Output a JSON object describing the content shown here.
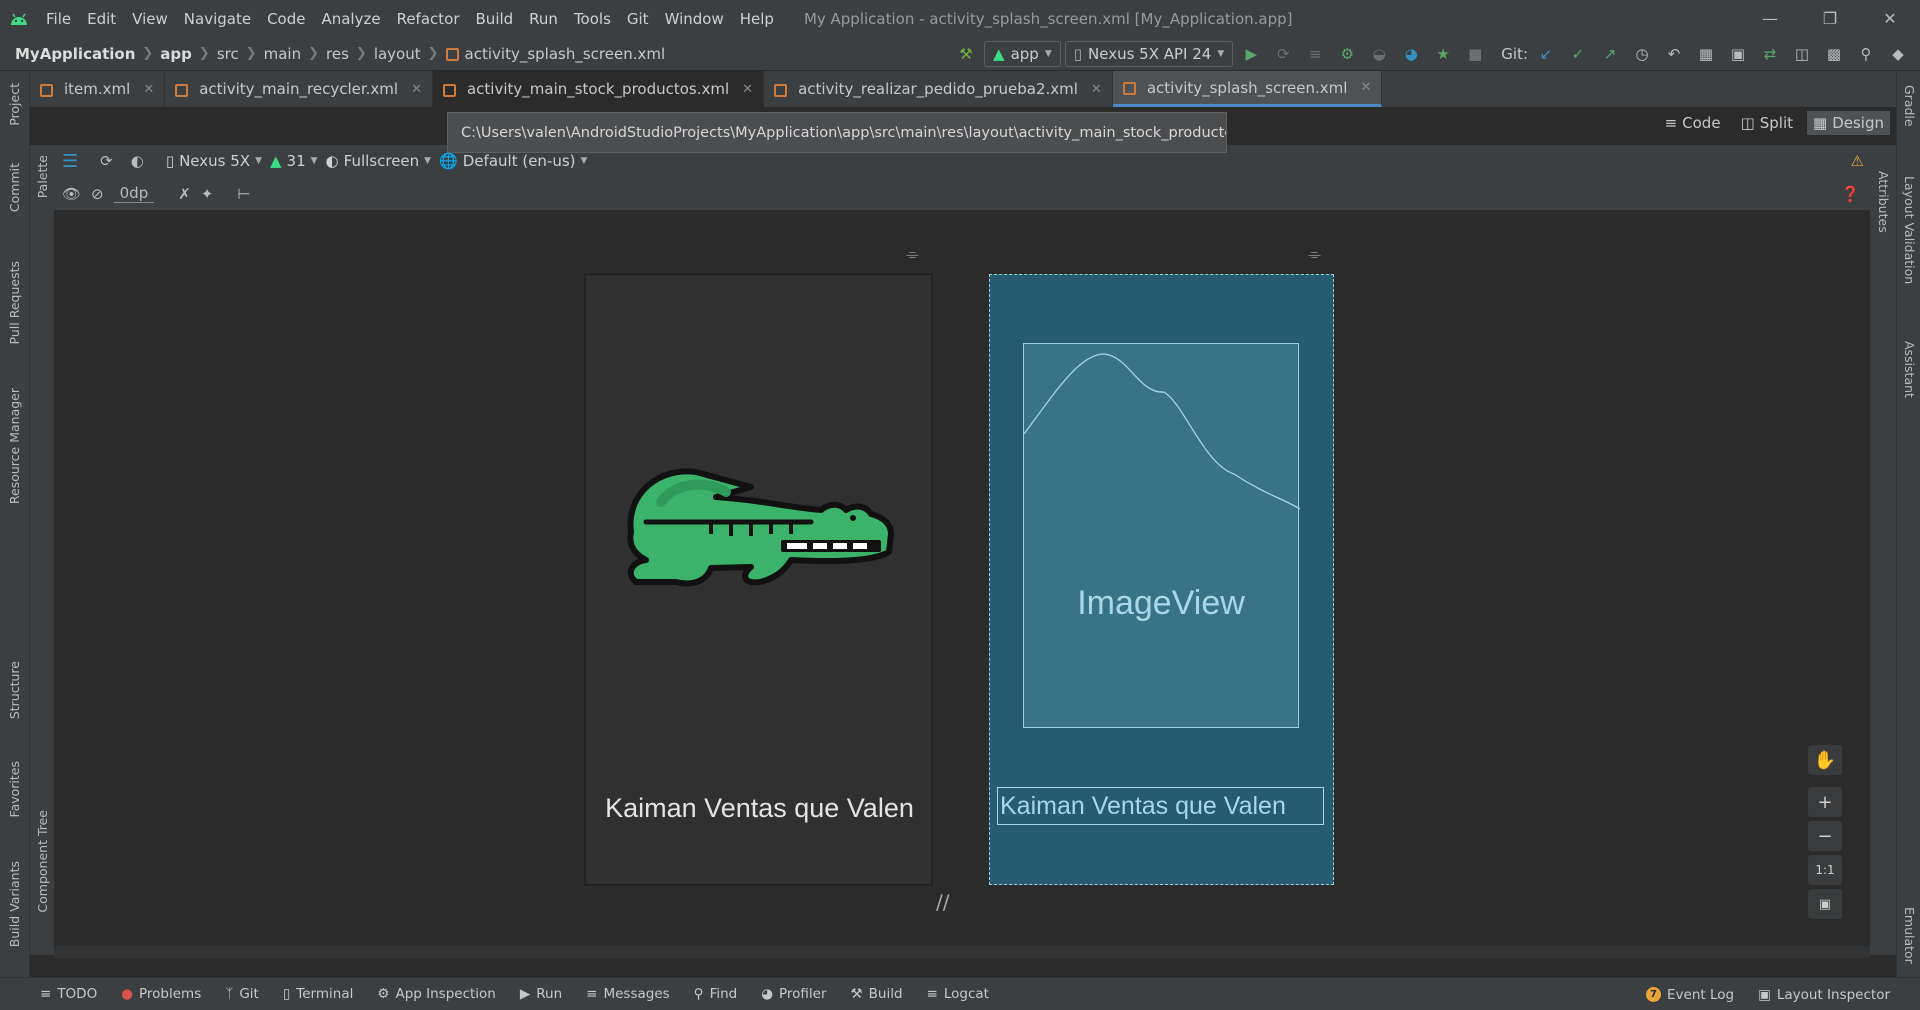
{
  "menubar": {
    "items": [
      "File",
      "Edit",
      "View",
      "Navigate",
      "Code",
      "Analyze",
      "Refactor",
      "Build",
      "Run",
      "Tools",
      "Git",
      "Window",
      "Help"
    ],
    "window_title": "My Application - activity_splash_screen.xml [My_Application.app]"
  },
  "breadcrumb": {
    "items": [
      "MyApplication",
      "app",
      "src",
      "main",
      "res",
      "layout",
      "activity_splash_screen.xml"
    ]
  },
  "toolbar": {
    "run_config": "app",
    "device": "Nexus 5X API 24",
    "git_label": "Git:"
  },
  "tabs": [
    {
      "label": "item.xml"
    },
    {
      "label": "activity_main_recycler.xml"
    },
    {
      "label": "activity_main_stock_productos.xml"
    },
    {
      "label": "activity_realizar_pedido_prueba2.xml"
    },
    {
      "label": "activity_splash_screen.xml"
    }
  ],
  "tooltip": {
    "path": "C:\\Users\\valen\\AndroidStudioProjects\\MyApplication\\app\\src\\main\\res\\layout\\activity_main_stock_productos.xml"
  },
  "view_modes": {
    "code": "Code",
    "split": "Split",
    "design": "Design"
  },
  "design_toolbar": {
    "device": "Nexus 5X",
    "api": "31",
    "mode": "Fullscreen",
    "locale": "Default (en-us)",
    "margin": "0dp"
  },
  "left_tools": {
    "project": "Project",
    "commit": "Commit",
    "pull_requests": "Pull Requests",
    "resource_manager": "Resource Manager",
    "structure": "Structure",
    "favorites": "Favorites",
    "build_variants": "Build Variants"
  },
  "inner_left_tools": {
    "palette": "Palette",
    "component_tree": "Component Tree"
  },
  "right_tools": {
    "gradle": "Gradle",
    "layout_validation": "Layout Validation",
    "assistant": "Assistant",
    "emulator": "Emulator",
    "attributes": "Attributes"
  },
  "preview": {
    "app_title": "Kaiman Ventas que Valen",
    "imageview_label": "ImageView",
    "textview_text": "Kaiman Ventas que Valen"
  },
  "zoom": {
    "plus": "+",
    "minus": "−",
    "one_to_one": "1:1"
  },
  "statusbar": {
    "todo": "TODO",
    "problems": "Problems",
    "git": "Git",
    "terminal": "Terminal",
    "app_inspection": "App Inspection",
    "run": "Run",
    "messages": "Messages",
    "find": "Find",
    "profiler": "Profiler",
    "build": "Build",
    "logcat": "Logcat",
    "event_log_count": "7",
    "event_log": "Event Log",
    "layout_inspector": "Layout Inspector"
  },
  "colors": {
    "accent": "#4a88c7",
    "blueprint": "#255c70",
    "crocodile": "#3bb36b",
    "warning": "#e9a43a"
  }
}
